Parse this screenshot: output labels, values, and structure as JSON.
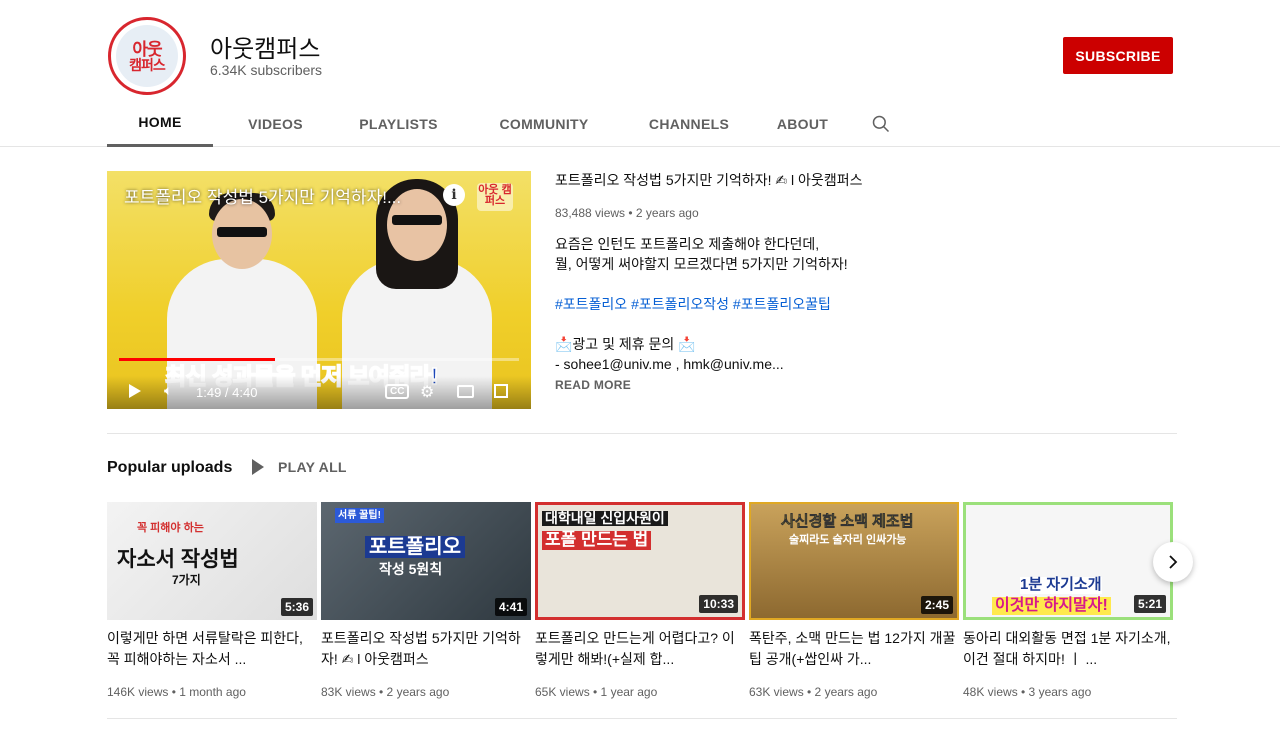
{
  "channel": {
    "name": "아웃캠퍼스",
    "subscribers": "6.34K subscribers",
    "avatar_text_top": "아웃",
    "avatar_text_bottom": "캠퍼스",
    "subscribe_label": "SUBSCRIBE"
  },
  "tabs": [
    {
      "label": "HOME",
      "active": true
    },
    {
      "label": "VIDEOS"
    },
    {
      "label": "PLAYLISTS"
    },
    {
      "label": "COMMUNITY"
    },
    {
      "label": "CHANNELS"
    },
    {
      "label": "ABOUT"
    }
  ],
  "featured": {
    "player_title": "포트폴리오 작성법 5가지만 기억하자!...",
    "player_logo": "아웃 캠퍼스",
    "player_caption": "최신 성과물을 먼저 보여줘라!",
    "time": "1:49 / 4:40",
    "progress_fraction": 0.39,
    "title": "포트폴리오 작성법 5가지만 기억하자! ✍ l 아웃캠퍼스",
    "meta": "83,488 views • 2 years ago",
    "desc_line1": "요즘은 인턴도 포트폴리오 제출해야 한다던데,",
    "desc_line2": "뭘, 어떻게 써야할지 모르겠다면 5가지만 기억하자!",
    "hashtags": "#포트폴리오 #포트폴리오작성 #포트폴리오꿀팁",
    "contact_line1": "📩광고 및 제휴 문의 📩",
    "contact_line2": "- sohee1@univ.me , hmk@univ.me...",
    "read_more": "READ MORE"
  },
  "shelf": {
    "title": "Popular uploads",
    "play_all": "PLAY ALL",
    "videos": [
      {
        "thumb_top": "꼭 피해야 하는",
        "thumb_main": "자소서 작성법",
        "thumb_sub": "7가지",
        "duration": "5:36",
        "title": "이렇게만 하면 서류탈락은 피한다, 꼭 피해야하는 자소서 ...",
        "meta": "146K views • 1 month ago"
      },
      {
        "thumb_top": "서류 꿀팁!",
        "thumb_main": "포트폴리오",
        "thumb_sub": "작성 5원칙",
        "duration": "4:41",
        "title": "포트폴리오 작성법 5가지만 기억하자! ✍ l 아웃캠퍼스",
        "meta": "83K views • 2 years ago"
      },
      {
        "thumb_top": "대학내일 신입사원이",
        "thumb_main": "포폴 만드는 법",
        "thumb_sub": "",
        "duration": "10:33",
        "title": "포트폴리오 만드는게 어렵다고? 이렇게만 해봐!(+실제 합...",
        "meta": "65K views • 1 year ago"
      },
      {
        "thumb_top": "사신경할 소맥 제조법",
        "thumb_main": "술찌라도 술자리 인싸가능",
        "thumb_sub": "",
        "duration": "2:45",
        "title": "폭탄주, 소맥 만드는 법 12가지 개꿀팁 공개(+쌉인싸 가...",
        "meta": "63K views • 2 years ago"
      },
      {
        "thumb_top": "",
        "thumb_main": "1분 자기소개",
        "thumb_sub": "이것만 하지말자!",
        "duration": "5:21",
        "title": "동아리 대외활동 면접 1분 자기소개, 이건 절대 하지마! ㅣ ...",
        "meta": "48K views • 3 years ago"
      }
    ]
  },
  "icons": {
    "search": "search-icon",
    "next": "chevron-right-icon"
  },
  "colors": {
    "subscribe": "#cc0000",
    "link": "#065fd4",
    "progress": "#ff0000"
  }
}
